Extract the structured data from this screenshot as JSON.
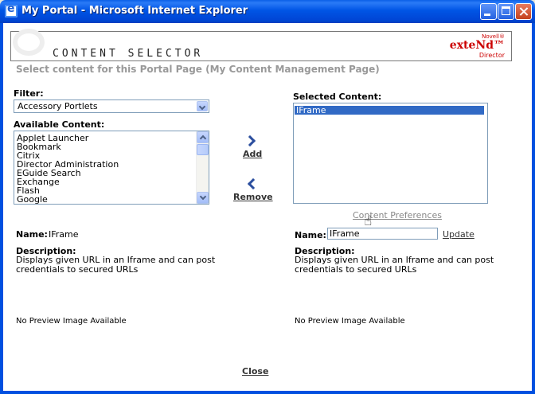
{
  "window": {
    "title": "My Portal - Microsoft Internet Explorer"
  },
  "header": {
    "title": "CONTENT SELECTOR",
    "brand_top": "Novell®",
    "brand_name": "exteNd™",
    "brand_sub": "Director"
  },
  "subtitle": "Select content for this Portal Page (My Content Management Page)",
  "filter": {
    "label": "Filter:",
    "selected": "Accessory Portlets"
  },
  "available": {
    "label": "Available Content:",
    "items": [
      "Applet Launcher",
      "Bookmark",
      "Citrix",
      "Director Administration",
      "EGuide Search",
      "Exchange",
      "Flash",
      "Google"
    ]
  },
  "selected_content": {
    "label": "Selected Content:",
    "items": [
      "IFrame"
    ]
  },
  "actions": {
    "add": "Add",
    "remove": "Remove",
    "content_preferences": "Content Preferences",
    "close": "Close"
  },
  "left_detail": {
    "name_label": "Name:",
    "name_value": "IFrame",
    "desc_label": "Description:",
    "desc_line1": "Displays given URL in an Iframe and can post",
    "desc_line2": "credentials to secured URLs",
    "preview": "No Preview Image Available"
  },
  "right_detail": {
    "name_label": "Name:",
    "name_value": "IFrame",
    "update": "Update",
    "desc_label": "Description:",
    "desc_line1": "Displays given URL in an Iframe and can post",
    "desc_line2": "credentials to secured URLs",
    "preview": "No Preview Image Available"
  }
}
